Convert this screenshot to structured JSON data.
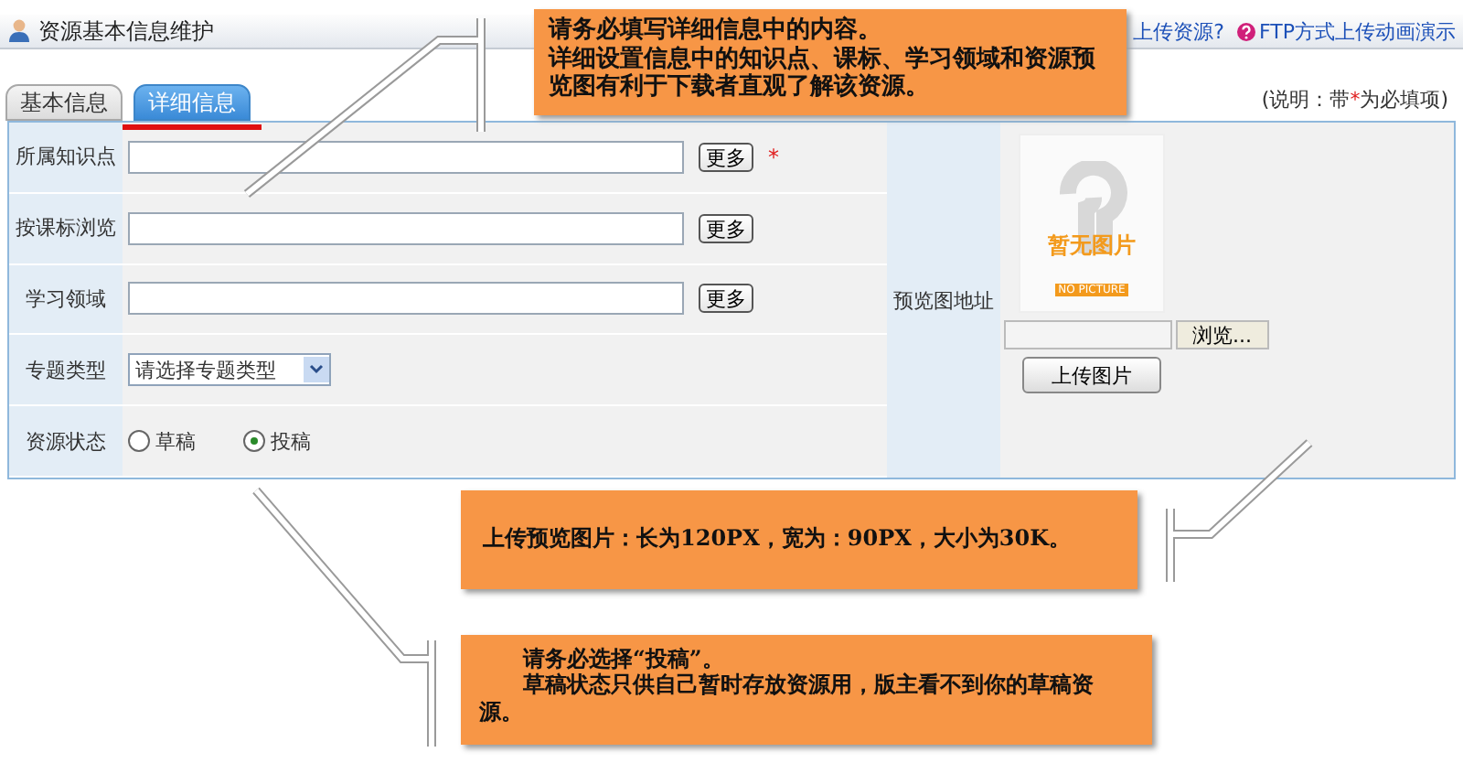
{
  "header": {
    "title": "资源基本信息维护",
    "links": [
      {
        "kind": "plain",
        "label": "上传资源?"
      },
      {
        "kind": "help",
        "label": "FTP方式上传动画演示"
      }
    ]
  },
  "tabs": [
    {
      "label": "基本信息",
      "selected": false
    },
    {
      "label": "详细信息",
      "selected": true
    }
  ],
  "note": {
    "before": "(说明：带",
    "mark": "*",
    "after": "为必填项)"
  },
  "fields": [
    {
      "kind": "text",
      "label": "所属知识点",
      "button": "更多",
      "required_mark": "*"
    },
    {
      "kind": "text",
      "label": "按课标浏览",
      "button": "更多"
    },
    {
      "kind": "text",
      "label": "学习领域",
      "button": "更多"
    },
    {
      "kind": "select",
      "label": "专题类型",
      "value": "请选择专题类型"
    },
    {
      "kind": "radio",
      "label": "资源状态",
      "options": [
        {
          "label": "草稿",
          "selected": false
        },
        {
          "label": "投稿",
          "selected": true
        }
      ]
    }
  ],
  "preview": {
    "label": "预览图地址",
    "image_title": "暂无图片",
    "image_caption": "NO PICTURE",
    "browse_button": "浏览...",
    "upload_button": "上传图片"
  },
  "callouts": [
    {
      "paragraphs": [
        "请务必填写详细信息中的内容。",
        "详细设置信息中的知识点、课标、学习领域和资源预览图有利于下载者直观了解该资源。"
      ]
    },
    {
      "paragraphs": [
        "上传预览图片：长为120PX，宽为：90PX，大小为30K。"
      ]
    },
    {
      "paragraphs": [
        "请务必选择“投稿”。",
        "草稿状态只供自己暂时存放资源用，版主看不到你的草稿资源。"
      ]
    }
  ]
}
